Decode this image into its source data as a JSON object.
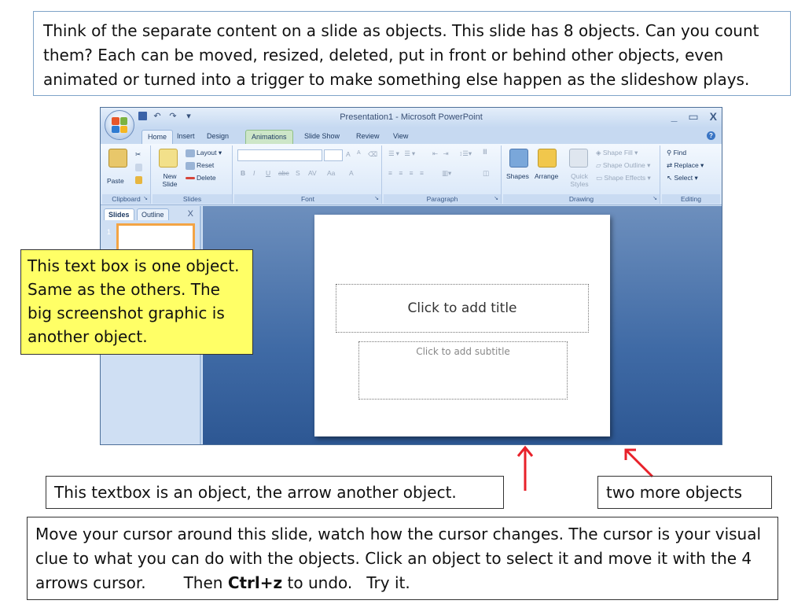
{
  "callouts": {
    "top": "Think of the separate content on a slide as objects.  This slide has 8 objects. Can you count them?   Each can be moved, resized, deleted, put in front or behind other objects, even animated or turned into a trigger to make something else happen as the slideshow plays.",
    "yellow": "This text box is one object.  Same as the others.  The big screenshot graphic is another object.",
    "middle": "This textbox is an object, the arrow another object.",
    "two_more": "two more objects",
    "bottom_part1": "Move your cursor around this slide, watch how the cursor changes. The cursor is your visual clue to what you can do with the objects.  Click an object to select it and move it with the 4 arrows cursor.",
    "bottom_then": "Then ",
    "bottom_shortcut": "Ctrl+z",
    "bottom_undo": " to undo.",
    "bottom_try": "Try it."
  },
  "colors": {
    "arrow": "#e8212a",
    "callout_highlight": "#ffff66",
    "workspace": "#3f6aa5"
  },
  "window": {
    "title": "Presentation1 - Microsoft PowerPoint",
    "controls": {
      "minimize": "_",
      "maximize": "▭",
      "close": "X"
    },
    "qat": {
      "save_icon": "save-icon",
      "undo": "↶",
      "redo": "↷",
      "customize": "▾"
    }
  },
  "tabs": [
    "Home",
    "Insert",
    "Design",
    "Animations",
    "Slide Show",
    "Review",
    "View"
  ],
  "ribbon": {
    "clipboard": {
      "paste": "Paste",
      "label": "Clipboard"
    },
    "slides": {
      "new_slide": "New Slide",
      "layout": "Layout",
      "reset": "Reset",
      "delete": "Delete",
      "label": "Slides"
    },
    "font": {
      "label": "Font",
      "bold": "B",
      "italic": "I",
      "underline": "U",
      "strike": "abc",
      "shadow": "S",
      "spacing": "AV",
      "case": "Aa",
      "color": "A",
      "grow": "A",
      "shrink": "A"
    },
    "paragraph": {
      "label": "Paragraph"
    },
    "drawing": {
      "shapes": "Shapes",
      "arrange": "Arrange",
      "quick_styles": "Quick Styles",
      "shape_fill": "Shape Fill",
      "shape_outline": "Shape Outline",
      "shape_effects": "Shape Effects",
      "label": "Drawing"
    },
    "editing": {
      "find": "Find",
      "replace": "Replace",
      "select": "Select",
      "label": "Editing"
    }
  },
  "pane": {
    "tab_slides": "Slides",
    "tab_outline": "Outline",
    "close": "X",
    "thumb_number": "1"
  },
  "slide": {
    "title_placeholder": "Click to add title",
    "subtitle_placeholder": "Click to add subtitle"
  }
}
